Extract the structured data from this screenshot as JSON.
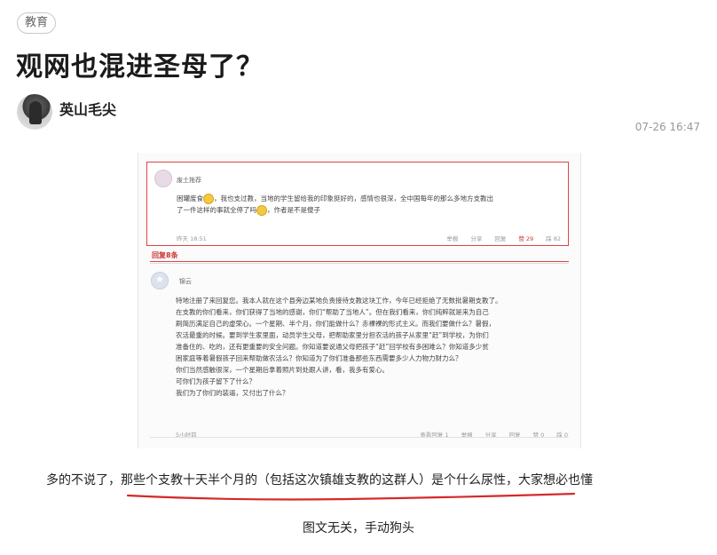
{
  "article": {
    "tag": "教育",
    "title": "观网也混进圣母了？",
    "author": "英山毛尖",
    "date": "07-26 16:47",
    "paragraph": "多的不说了，那些个支教十天半个月的（包括这次镇雄支教的这群人）是个什么尿性，大家想必也懂",
    "caption": "图文无关，手动狗头"
  },
  "screenshot": {
    "hot_comment": {
      "user": "废土拖荐",
      "text_part1": "困罐废食",
      "text_part2": "，我也支过教，当地的学生留给我的印象挺好的，感情也很深，全中国每年的那么多地方支教出",
      "text_part3": "了一件这样的事就全停了吗",
      "text_part4": "，作者是不是傻子",
      "time": "昨天 18:51",
      "actions": [
        "举报",
        "分享",
        "回复"
      ],
      "likes": "赞 29",
      "dislikes": "踩 82"
    },
    "replies_label": "回复8条",
    "reply": {
      "user": "锦云",
      "lines": [
        "特地注册了来回复您。我本人就在这个县旁边某地负责接待支教这块工作，今年已经拒绝了无数批暑期支教了。",
        "在支教的你们看来，你们获得了当地的感谢，你们“帮助了当地人”。但在我们看来，你们纯粹就是来为自己",
        "刷简历满足自己的虚荣心。一个星期、半个月，你们能做什么？赤裸裸的形式主义。而我们要做什么？暑假，",
        "农活最重的时候。要到学生家里面，动员学生父母，把帮助家里分担农活的孩子从家里“赶”到学校，为你们",
        "准备住的、吃的，还有更重要的安全问题。你知道要说通父母把孩子“赶”回学校有多困难么？你知道多少贫",
        "困家庭等着暑假孩子回来帮助做农活么？你知道为了你们准备那些东西需要多少人力物力财力么？",
        "你们当然感触很深，一个星期后拿着照片到处跟人讲，看，我多有爱心。",
        "可你们为孩子留下了什么？",
        "我们为了你们的装逼，又付出了什么？"
      ],
      "time": "5小时前",
      "actions": [
        "查看回复 1",
        "举报",
        "分享",
        "回复",
        "赞 0",
        "踩 0"
      ]
    }
  },
  "colors": {
    "accent_red": "#d42a2a",
    "text": "#222222",
    "muted": "#999999"
  }
}
